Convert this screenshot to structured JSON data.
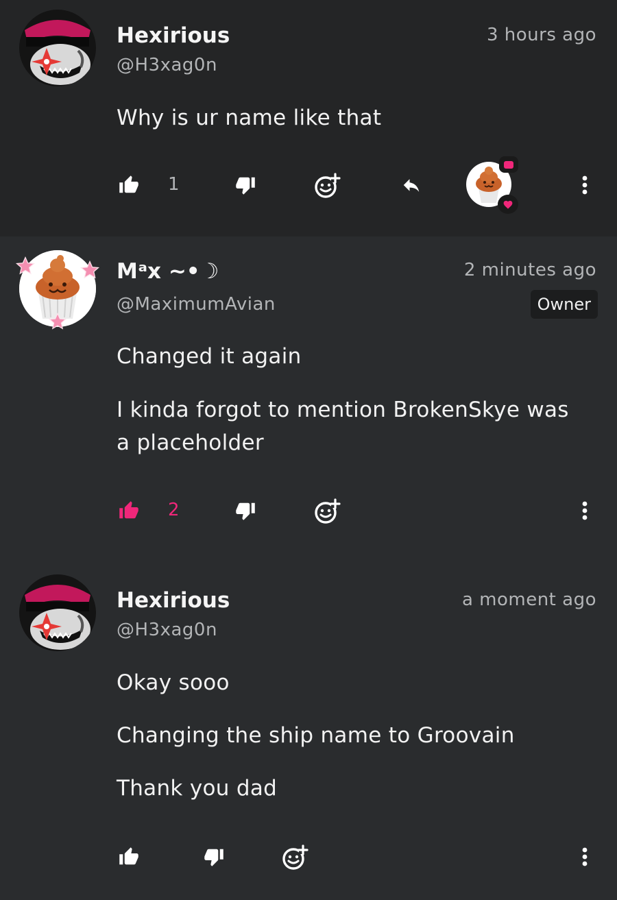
{
  "accent": "#f0277a",
  "comments": [
    {
      "name": "Hexirious",
      "handle": "@H3xag0n",
      "time": "3 hours ago",
      "body": [
        "Why is ur name like that"
      ],
      "likes": "1",
      "liked": false
    },
    {
      "name": "Mᵃx ~•☽",
      "handle": "@MaximumAvian",
      "time": "2 minutes ago",
      "badge": "Owner",
      "body": [
        "Changed it again",
        "I kinda forgot to mention BrokenSkye was",
        "a placeholder"
      ],
      "likes": "2",
      "liked": true
    },
    {
      "name": "Hexirious",
      "handle": "@H3xag0n",
      "time": "a moment ago",
      "body": [
        "Okay sooo",
        "Changing the ship name to Groovain",
        "Thank you dad"
      ]
    }
  ]
}
